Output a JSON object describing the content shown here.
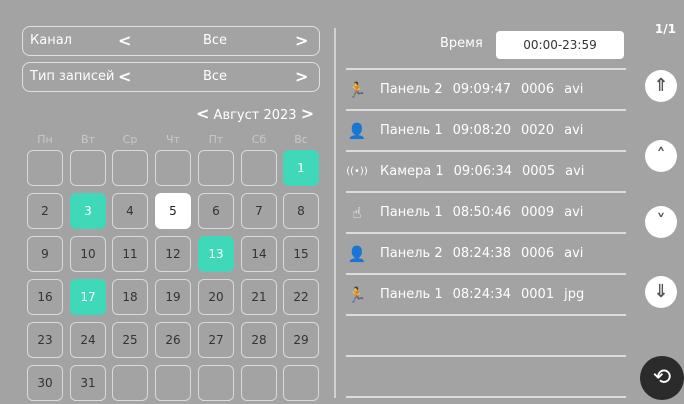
{
  "filters": {
    "channel_label": "Канал",
    "channel_value": "Все",
    "type_label": "Тип записей",
    "type_value": "Все",
    "prev_glyph": "<",
    "next_glyph": ">"
  },
  "calendar": {
    "month_label": "Август 2023",
    "weekdays": [
      "Пн",
      "Вт",
      "Ср",
      "Чт",
      "Пт",
      "Сб",
      "Вс"
    ],
    "days": [
      "1",
      "2",
      "3",
      "4",
      "5",
      "6",
      "7",
      "8",
      "9",
      "10",
      "11",
      "12",
      "13",
      "14",
      "15",
      "16",
      "17",
      "18",
      "19",
      "20",
      "21",
      "22",
      "23",
      "24",
      "25",
      "26",
      "27",
      "28",
      "29",
      "30",
      "31"
    ],
    "highlighted_days": [
      "1",
      "3",
      "13",
      "17"
    ],
    "selected_day": "5",
    "highlight_color": "#3fd8b8"
  },
  "time_filter": {
    "label": "Время",
    "value": "00:00-23:59"
  },
  "records": [
    {
      "icon": "running-person-icon",
      "source": "Панель 2",
      "time": "09:09:47",
      "count": "0006",
      "format": "avi"
    },
    {
      "icon": "person-alert-icon",
      "source": "Панель 1",
      "time": "09:08:20",
      "count": "0020",
      "format": "avi"
    },
    {
      "icon": "broadcast-icon",
      "source": "Камера 1",
      "time": "09:06:34",
      "count": "0005",
      "format": "avi"
    },
    {
      "icon": "tap-alert-icon",
      "source": "Панель 1",
      "time": "08:50:46",
      "count": "0009",
      "format": "avi"
    },
    {
      "icon": "person-icon",
      "source": "Панель 2",
      "time": "08:24:38",
      "count": "0006",
      "format": "avi"
    },
    {
      "icon": "running-person-icon",
      "source": "Панель 1",
      "time": "08:24:34",
      "count": "0001",
      "format": "jpg"
    }
  ],
  "pagination": {
    "page_indicator": "1/1"
  }
}
